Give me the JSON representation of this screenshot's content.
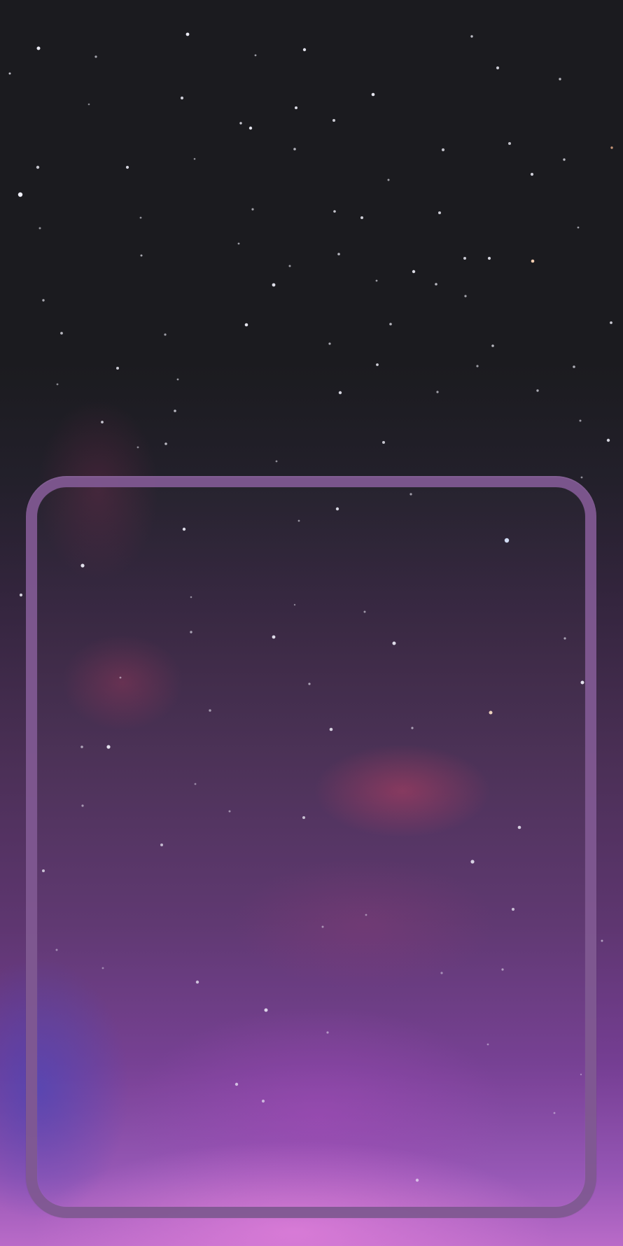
{
  "scene": {
    "description_hint": "",
    "colors": {
      "night_sky": "#1b1b1f",
      "magenta_glow": "#b96bc8",
      "frame": "#805891"
    }
  }
}
